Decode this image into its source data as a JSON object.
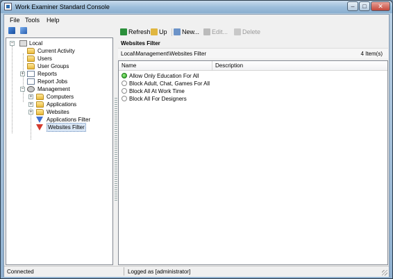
{
  "window": {
    "title": "Work Examiner Standard Console",
    "min": "–",
    "max": "□",
    "close": "✕"
  },
  "menu": {
    "items": [
      "File",
      "Tools",
      "Help"
    ]
  },
  "tree": {
    "root": "Local",
    "items": [
      {
        "label": "Current Activity",
        "icon": "folder-icon"
      },
      {
        "label": "Users",
        "icon": "folder-icon"
      },
      {
        "label": "User Groups",
        "icon": "folder-icon"
      },
      {
        "label": "Reports",
        "icon": "report-icon"
      },
      {
        "label": "Report Jobs",
        "icon": "report-icon"
      },
      {
        "label": "Management",
        "icon": "gear-icon"
      },
      {
        "label": "Computers",
        "icon": "folder-icon"
      },
      {
        "label": "Applications",
        "icon": "folder-icon"
      },
      {
        "label": "Websites",
        "icon": "folder-icon"
      },
      {
        "label": "Applications Filter",
        "icon": "funnel-icon"
      },
      {
        "label": "Websites Filter",
        "icon": "funnel-icon"
      }
    ]
  },
  "toolbar": {
    "refresh": "Refresh",
    "up": "Up",
    "new": "New...",
    "edit": "Edit...",
    "delete": "Delete"
  },
  "main": {
    "title": "Websites Filter",
    "path": "Local\\Management\\Websites Filter",
    "count": "4 Item(s)",
    "columns": {
      "name": "Name",
      "description": "Description"
    },
    "rows": [
      {
        "name": "Allow Only Education For All",
        "active": true
      },
      {
        "name": "Block Adult, Chat, Games For All",
        "active": false
      },
      {
        "name": "Block All At Work Time",
        "active": false
      },
      {
        "name": "Block All For Designers",
        "active": false
      }
    ]
  },
  "status": {
    "left": "Connected",
    "right": "Logged as  [administrator]"
  }
}
